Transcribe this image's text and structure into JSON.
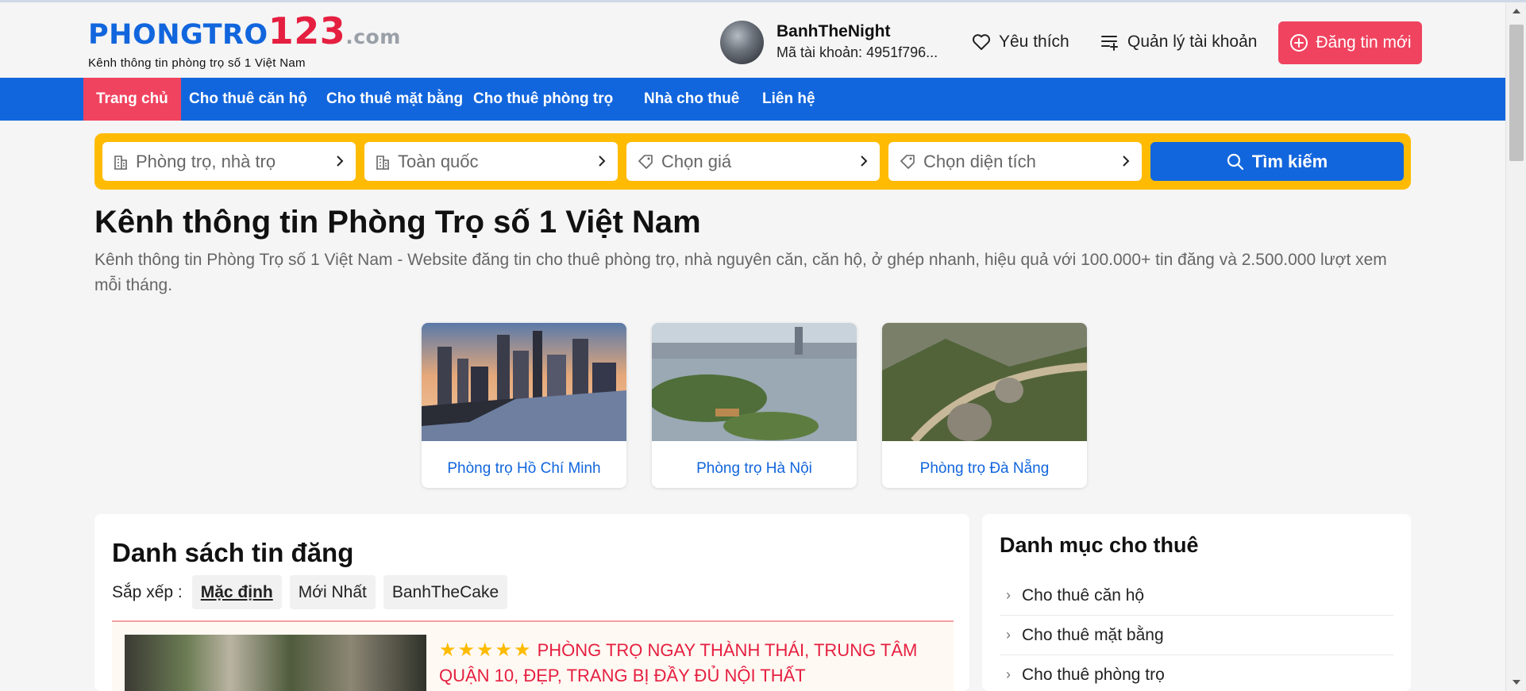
{
  "header": {
    "logo_brand": "PHONGTRO",
    "logo_number": "123",
    "logo_domain": ".com",
    "logo_tagline": "Kênh thông tin phòng trọ số 1 Việt Nam",
    "user_name": "BanhTheNight",
    "user_account_id": "Mã tài khoản: 4951f796...",
    "favorites_label": "Yêu thích",
    "account_label": "Quản lý tài khoản",
    "post_button_label": "Đăng tin mới",
    "icons": {
      "favorites": "heart-icon",
      "account": "list-icon",
      "post": "plus-circle-icon"
    }
  },
  "nav": {
    "items": [
      {
        "label": "Trang chủ",
        "active": true
      },
      {
        "label": "Cho thuê căn hộ",
        "active": false
      },
      {
        "label": "Cho thuê mặt bằng",
        "active": false
      },
      {
        "label": "Cho thuê phòng trọ",
        "active": false
      },
      {
        "label": "Nhà cho thuê",
        "active": false
      },
      {
        "label": "Liên hệ",
        "active": false
      }
    ]
  },
  "search": {
    "fields": [
      {
        "label": "Phòng trọ, nhà trọ",
        "icon": "building-icon"
      },
      {
        "label": "Toàn quốc",
        "icon": "building-icon"
      },
      {
        "label": "Chọn giá",
        "icon": "tag-icon"
      },
      {
        "label": "Chọn diện tích",
        "icon": "tag-icon"
      }
    ],
    "button_label": "Tìm kiếm"
  },
  "main": {
    "title": "Kênh thông tin Phòng Trọ số 1 Việt Nam",
    "description": "Kênh thông tin Phòng Trọ số 1 Việt Nam - Website đăng tin cho thuê phòng trọ, nhà nguyên căn, căn hộ, ở ghép nhanh, hiệu quả với 100.000+ tin đăng và 2.500.000 lượt xem mỗi tháng."
  },
  "cities": [
    {
      "label": "Phòng trọ Hồ Chí Minh"
    },
    {
      "label": "Phòng trọ Hà Nội"
    },
    {
      "label": "Phòng trọ Đà Nẵng"
    }
  ],
  "listing": {
    "title": "Danh sách tin đăng",
    "sort_label": "Sắp xếp :",
    "sort_options": [
      {
        "label": "Mặc định",
        "active": true
      },
      {
        "label": "Mới Nhất",
        "active": false
      },
      {
        "label": "BanhTheCake",
        "active": false
      }
    ],
    "items": [
      {
        "stars": 5,
        "title": "PHÒNG TRỌ NGAY THÀNH THÁI, TRUNG TÂM QUẬN 10, ĐẸP, TRANG BỊ ĐẦY ĐỦ NỘI THẤT"
      }
    ]
  },
  "sidebar": {
    "title": "Danh mục cho thuê",
    "items": [
      {
        "label": "Cho thuê căn hộ"
      },
      {
        "label": "Cho thuê mặt bằng"
      },
      {
        "label": "Cho thuê phòng trọ"
      }
    ]
  },
  "colors": {
    "brand_blue": "#1266dd",
    "brand_red": "#e51f40",
    "accent_pink": "#f0435f",
    "search_yellow": "#febb02"
  }
}
